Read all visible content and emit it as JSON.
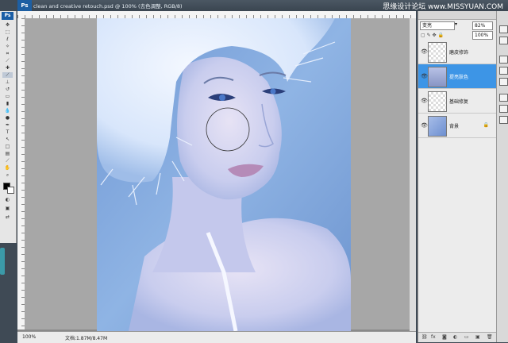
{
  "app": {
    "logo": "Ps"
  },
  "document": {
    "title": "clean and creative retouch.psd @ 100% (去色调整, RGB/8)",
    "zoom": "100%",
    "doc_info": "文档:1.87M/8.47M"
  },
  "watermark": "思缘设计论坛 www.MISSYUAN.COM",
  "layers_panel": {
    "blend_mode": "变亮",
    "opacity": "82%",
    "fill": "100%",
    "layers": [
      {
        "name": "磨皮修饰",
        "selected": false,
        "visible": true
      },
      {
        "name": "提亮肤色",
        "selected": true,
        "visible": true
      },
      {
        "name": "基础修复",
        "selected": false,
        "visible": true
      },
      {
        "name": "背景",
        "selected": false,
        "visible": true,
        "locked": true
      }
    ]
  }
}
